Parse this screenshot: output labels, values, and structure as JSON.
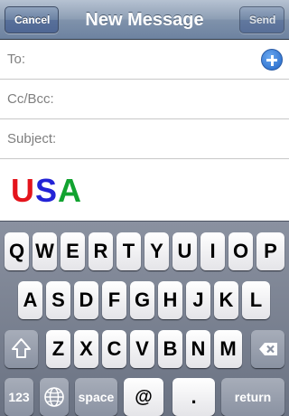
{
  "navbar": {
    "title": "New Message",
    "cancel_label": "Cancel",
    "send_label": "Send"
  },
  "fields": {
    "to_label": "To:",
    "ccbcc_label": "Cc/Bcc:",
    "subject_label": "Subject:"
  },
  "body": {
    "letters": [
      {
        "char": "U",
        "color": "#e4141c"
      },
      {
        "char": "S",
        "color": "#2323d6"
      },
      {
        "char": "A",
        "color": "#12a330"
      }
    ]
  },
  "keyboard": {
    "row1": [
      "Q",
      "W",
      "E",
      "R",
      "T",
      "Y",
      "U",
      "I",
      "O",
      "P"
    ],
    "row2": [
      "A",
      "S",
      "D",
      "F",
      "G",
      "H",
      "J",
      "K",
      "L"
    ],
    "row3": [
      "Z",
      "X",
      "C",
      "V",
      "B",
      "N",
      "M"
    ],
    "numbers_label": "123",
    "space_label": "space",
    "at_label": "@",
    "dot_label": ".",
    "return_label": "return",
    "icons": {
      "shift": "shift-icon",
      "delete": "delete-icon",
      "globe": "globe-icon",
      "add_contact": "add-contact-icon"
    }
  }
}
